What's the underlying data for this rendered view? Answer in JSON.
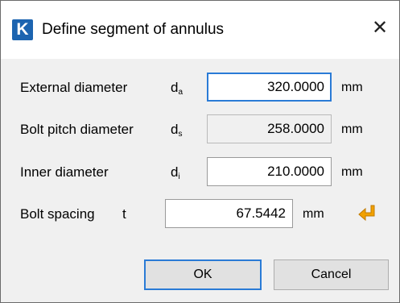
{
  "window": {
    "icon_letter": "K",
    "title": "Define segment of annulus",
    "close_glyph": "✕"
  },
  "fields": {
    "external": {
      "label": "External diameter",
      "symbol": "d",
      "subscript": "a",
      "value": "320.0000",
      "unit": "mm"
    },
    "bolt_pitch": {
      "label": "Bolt pitch diameter",
      "symbol": "d",
      "subscript": "s",
      "value": "258.0000",
      "unit": "mm"
    },
    "inner": {
      "label": "Inner diameter",
      "symbol": "d",
      "subscript": "i",
      "value": "210.0000",
      "unit": "mm"
    },
    "bolt_spacing": {
      "label": "Bolt spacing",
      "symbol": "t",
      "value": "67.5442",
      "unit": "mm"
    }
  },
  "icons": {
    "transfer": "arrow-enter-icon"
  },
  "colors": {
    "accent": "#2a7bd6",
    "app_icon": "#1c64b0",
    "arrow": "#f2a100"
  },
  "buttons": {
    "ok": "OK",
    "cancel": "Cancel"
  }
}
